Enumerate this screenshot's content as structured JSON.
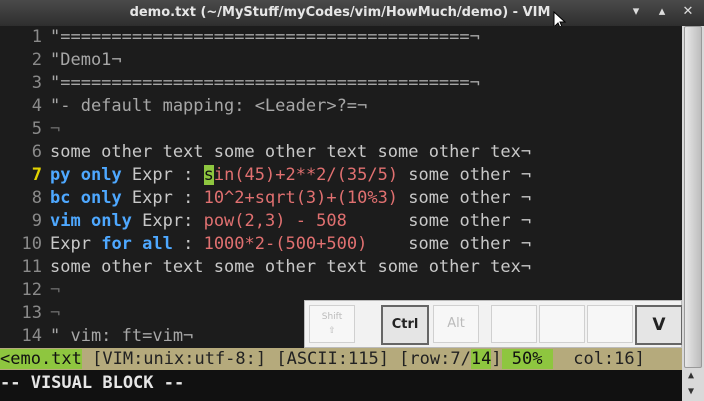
{
  "window": {
    "title": "demo.txt (~/MyStuff/myCodes/vim/HowMuch/demo) - VIM"
  },
  "lines": [
    {
      "num": "1",
      "text": "\"========================================¬"
    },
    {
      "num": "2",
      "text": "\"Demo1¬"
    },
    {
      "num": "3",
      "text": "\"========================================¬"
    },
    {
      "num": "4",
      "text": "\"- default mapping: <Leader>?=¬"
    },
    {
      "num": "5",
      "text": "¬"
    },
    {
      "num": "6",
      "text": "some other text some other text some other tex¬"
    },
    {
      "num": "7",
      "kw1": "py",
      "kw2": "only",
      "label": " Expr : ",
      "hl": "s",
      "expr": "in(45)+2**2/(35/5)",
      "tail": " some other ¬"
    },
    {
      "num": "8",
      "kw1": "bc",
      "kw2": "only",
      "label": " Expr : ",
      "expr": "10^2+sqrt(3)+(10%3)",
      "tail": " some other ¬"
    },
    {
      "num": "9",
      "kw1": "vim",
      "kw2": "only",
      "label": " Expr: ",
      "expr": "pow(2,3) - 508",
      "tail": "      some other ¬"
    },
    {
      "num": "10",
      "kw1": "Expr",
      "kw2": "for all",
      "label": " : ",
      "expr": "1000*2-(500+500)",
      "tail": "    some other ¬"
    },
    {
      "num": "11",
      "text": "some other text some other text some other tex¬"
    },
    {
      "num": "12",
      "text": "¬"
    },
    {
      "num": "13",
      "text": "¬"
    },
    {
      "num": "14",
      "text": "\" vim: ft=vim¬"
    }
  ],
  "keys": {
    "shift": "Shift",
    "ctrl": "Ctrl",
    "alt": "Alt",
    "v": "V"
  },
  "statusline": {
    "file": "<emo.txt",
    "info": " [VIM:unix:utf-8:] [ASCII:115] [row:7/",
    "row_total": "14",
    "percent": " 50% ",
    "col": "  col:16]"
  },
  "cmdline": "-- VISUAL BLOCK --",
  "colors": {
    "highlight": "#8ec63f",
    "statusline": "#b5aa7c",
    "keyword": "#4ea8ff",
    "expr": "#e07070"
  }
}
